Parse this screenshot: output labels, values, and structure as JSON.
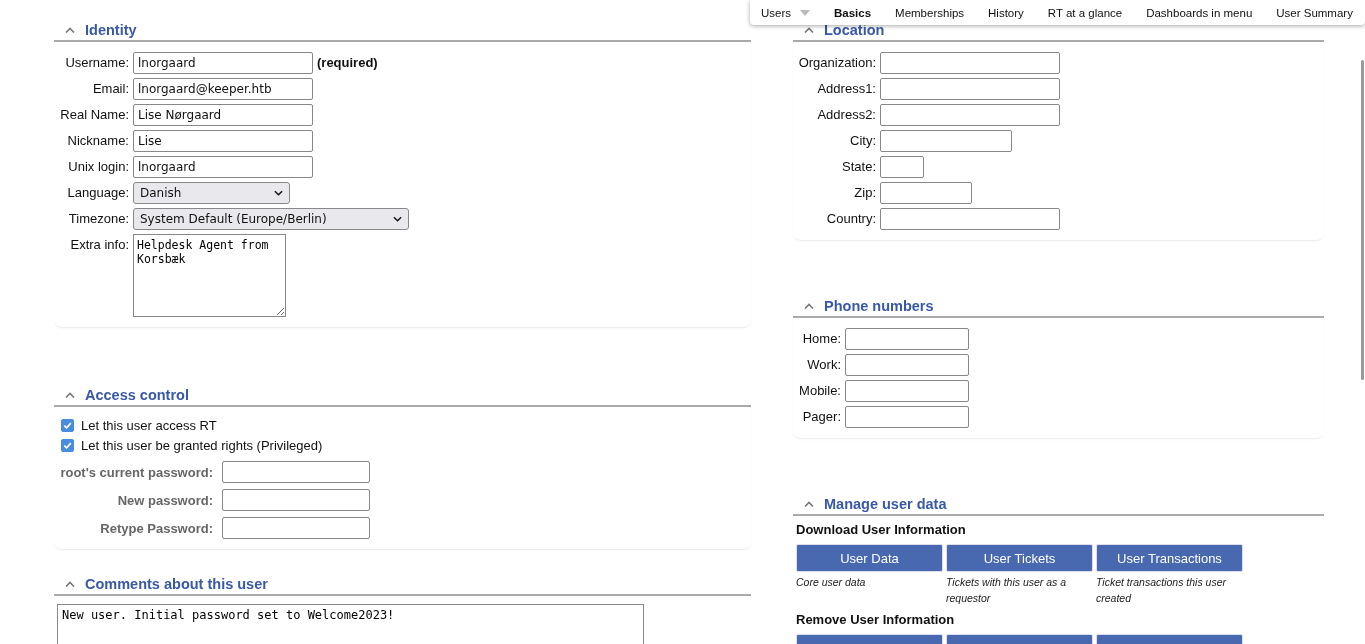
{
  "top_menu": {
    "items": [
      {
        "label": "Users",
        "kind": "dropdown",
        "selected": false
      },
      {
        "label": "Basics",
        "kind": "tab",
        "selected": true
      },
      {
        "label": "Memberships",
        "kind": "tab",
        "selected": false
      },
      {
        "label": "History",
        "kind": "tab",
        "selected": false
      },
      {
        "label": "RT at a glance",
        "kind": "tab",
        "selected": false
      },
      {
        "label": "Dashboards in menu",
        "kind": "tab",
        "selected": false
      },
      {
        "label": "User Summary",
        "kind": "tab",
        "selected": false
      }
    ]
  },
  "identity": {
    "title": "Identity",
    "fields": [
      {
        "label": "Username:",
        "kind": "text",
        "value": "lnorgaard",
        "note": "(required)"
      },
      {
        "label": "Email:",
        "kind": "text",
        "value": "lnorgaard@keeper.htb"
      },
      {
        "label": "Real Name:",
        "kind": "text",
        "value": "Lise Nørgaard"
      },
      {
        "label": "Nickname:",
        "kind": "text",
        "value": "Lise"
      },
      {
        "label": "Unix login:",
        "kind": "text",
        "value": "lnorgaard"
      },
      {
        "label": "Language:",
        "kind": "select",
        "value": "Danish"
      },
      {
        "label": "Timezone:",
        "kind": "select-wide",
        "value": "System Default (Europe/Berlin)"
      },
      {
        "label": "Extra info:",
        "kind": "textarea",
        "value": "Helpdesk Agent from Korsbæk"
      }
    ]
  },
  "access_control": {
    "title": "Access control",
    "checkboxes": [
      {
        "label": "Let this user access RT",
        "checked": true
      },
      {
        "label": "Let this user be granted rights (Privileged)",
        "checked": true
      }
    ],
    "password_fields": [
      {
        "label": "root's current password:"
      },
      {
        "label": "New password:"
      },
      {
        "label": "Retype Password:"
      }
    ]
  },
  "comments": {
    "title": "Comments about this user",
    "value": "New user. Initial password set to Welcome2023!"
  },
  "location": {
    "title": "Location",
    "fields": [
      {
        "label": "Organization:",
        "kind": "wide"
      },
      {
        "label": "Address1:",
        "kind": "wide"
      },
      {
        "label": "Address2:",
        "kind": "wide"
      },
      {
        "label": "City:",
        "kind": "medium"
      },
      {
        "label": "State:",
        "kind": "tiny"
      },
      {
        "label": "Zip:",
        "kind": "small"
      },
      {
        "label": "Country:",
        "kind": "wide"
      }
    ]
  },
  "phone_numbers": {
    "title": "Phone numbers",
    "fields": [
      {
        "label": "Home:"
      },
      {
        "label": "Work:"
      },
      {
        "label": "Mobile:"
      },
      {
        "label": "Pager:"
      }
    ]
  },
  "manage_user_data": {
    "title": "Manage user data",
    "download": {
      "heading": "Download User Information",
      "buttons": [
        {
          "label": "User Data",
          "description": "Core user data"
        },
        {
          "label": "User Tickets",
          "description": "Tickets with this user as a requestor"
        },
        {
          "label": "User Transactions",
          "description": "Ticket transactions this user created"
        }
      ]
    },
    "remove": {
      "heading": "Remove User Information",
      "buttons": [
        {
          "kind": "button"
        },
        {
          "kind": "button"
        },
        {
          "kind": "button"
        }
      ]
    }
  }
}
